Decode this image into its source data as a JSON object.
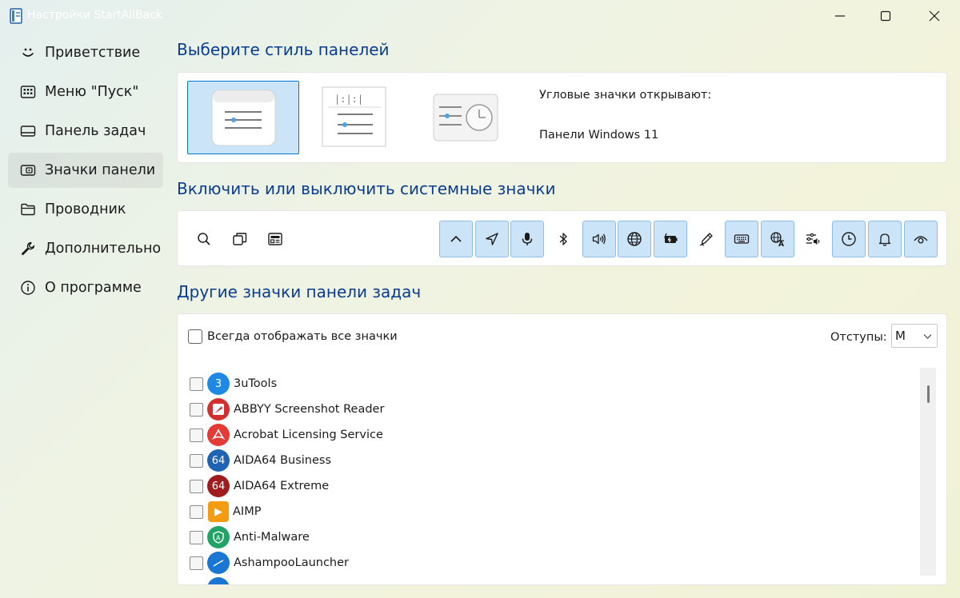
{
  "window": {
    "title": "Настройки StartAllBack"
  },
  "sidebar": {
    "items": [
      {
        "label": "Приветствие",
        "icon": "smiley-icon"
      },
      {
        "label": "Меню \"Пуск\"",
        "icon": "start-menu-icon"
      },
      {
        "label": "Панель задач",
        "icon": "taskbar-icon"
      },
      {
        "label": "Значки панели",
        "icon": "tray-icons-icon",
        "active": true
      },
      {
        "label": "Проводник",
        "icon": "folder-icon"
      },
      {
        "label": "Дополнительно",
        "icon": "wrench-icon"
      },
      {
        "label": "О программе",
        "icon": "info-icon"
      }
    ]
  },
  "panel_style": {
    "title": "Выберите стиль панелей",
    "selected_index": 0,
    "corner_label": "Угловые значки открывают:",
    "corner_value": "Панели Windows 11"
  },
  "system_icons": {
    "title": "Включить или выключить системные значки",
    "left_icons": [
      "search-icon",
      "task-view-icon",
      "widgets-icon"
    ],
    "right_icons": [
      {
        "name": "chevron-up-icon",
        "on": true
      },
      {
        "name": "location-icon",
        "on": true
      },
      {
        "name": "microphone-icon",
        "on": true
      },
      {
        "name": "bluetooth-icon",
        "on": false
      },
      {
        "name": "volume-icon",
        "on": true
      },
      {
        "name": "network-globe-icon",
        "on": true
      },
      {
        "name": "battery-charging-icon",
        "on": true
      },
      {
        "name": "pen-icon",
        "on": false
      },
      {
        "name": "keyboard-icon",
        "on": true
      },
      {
        "name": "language-icon",
        "on": true
      },
      {
        "name": "audio-settings-icon",
        "on": false
      },
      {
        "name": "clock-icon",
        "on": true
      },
      {
        "name": "bell-icon",
        "on": true
      },
      {
        "name": "eye-icon",
        "on": true
      }
    ]
  },
  "other_icons": {
    "title": "Другие значки панели задач",
    "always_show_label": "Всегда отображать все значки",
    "always_show_checked": false,
    "indent_label": "Отступы:",
    "indent_value": "M",
    "apps": [
      {
        "name": "3uTools",
        "glyph": "3",
        "color": "#1e88e5"
      },
      {
        "name": "ABBYY Screenshot Reader",
        "glyph": "",
        "color": "#d32f2f"
      },
      {
        "name": "Acrobat Licensing Service",
        "glyph": "",
        "color": "#e53935"
      },
      {
        "name": "AIDA64 Business",
        "glyph": "64",
        "color": "#1f63b4"
      },
      {
        "name": "AIDA64 Extreme",
        "glyph": "64",
        "color": "#a01c1c"
      },
      {
        "name": "AIMP",
        "glyph": "▶",
        "color": "#f39c12"
      },
      {
        "name": "Anti-Malware",
        "glyph": "A",
        "color": "#21a366"
      },
      {
        "name": "AshampooLauncher",
        "glyph": "",
        "color": "#1976d2"
      }
    ]
  }
}
